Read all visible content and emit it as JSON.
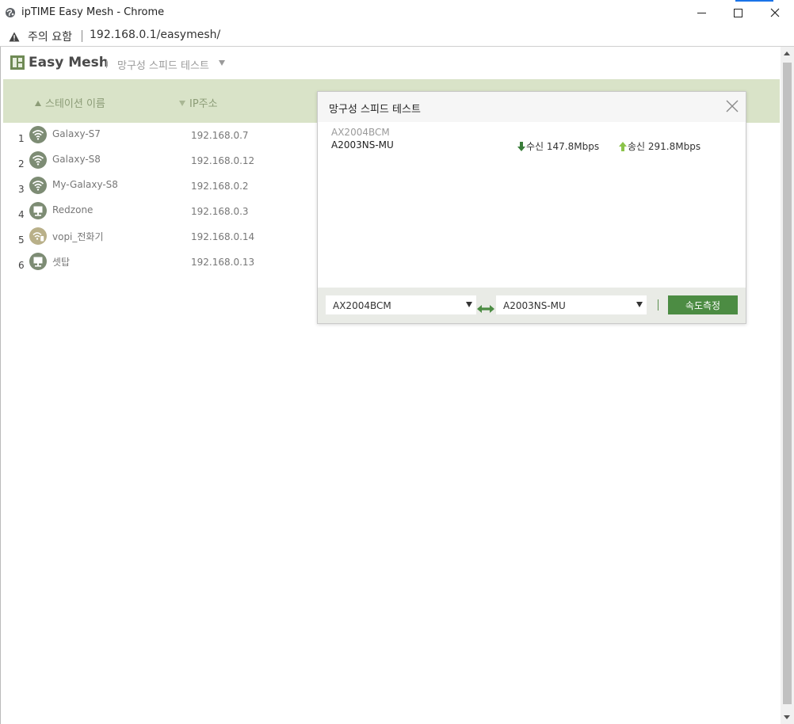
{
  "window": {
    "title": "ipTIME Easy Mesh - Chrome"
  },
  "address": {
    "security_label": "주의 요함",
    "url": "192.168.0.1/easymesh/"
  },
  "app": {
    "title": "Easy Mesh",
    "breadcrumb": "망구성 스피드 테스트"
  },
  "table": {
    "headers": {
      "name": "스테이션 이름",
      "ip": "IP주소"
    },
    "rows": [
      {
        "num": "1",
        "name": "Galaxy-S7",
        "ip": "192.168.0.7",
        "icon": "wifi-icon"
      },
      {
        "num": "2",
        "name": "Galaxy-S8",
        "ip": "192.168.0.12",
        "icon": "wifi-icon"
      },
      {
        "num": "3",
        "name": "My-Galaxy-S8",
        "ip": "192.168.0.2",
        "icon": "wifi-icon"
      },
      {
        "num": "4",
        "name": "Redzone",
        "ip": "192.168.0.3",
        "icon": "wired-icon"
      },
      {
        "num": "5",
        "name": "vopi_전화기",
        "ip": "192.168.0.14",
        "icon": "wifi-phone-icon"
      },
      {
        "num": "6",
        "name": "셋탑",
        "ip": "192.168.0.13",
        "icon": "wired-icon"
      }
    ]
  },
  "modal": {
    "title": "망구성 스피드 테스트",
    "result": {
      "source": "AX2004BCM",
      "target": "A2003NS-MU",
      "rx_label": "수신 147.8Mbps",
      "tx_label": "송신 291.8Mbps"
    },
    "select_a": "AX2004BCM",
    "select_b": "A2003NS-MU",
    "measure_label": "속도측정"
  },
  "colors": {
    "header_band": "#d9e3c8",
    "accent_green": "#4c8c43",
    "icon_gray": "#7d8c74"
  }
}
